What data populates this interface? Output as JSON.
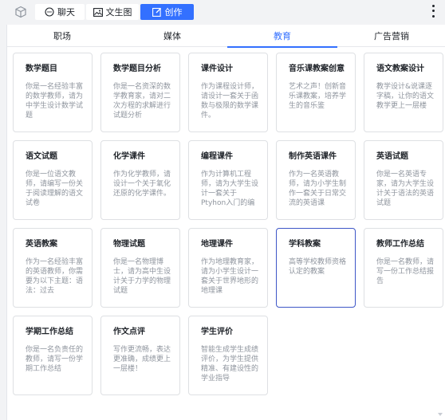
{
  "toolbar": {
    "modes": [
      {
        "label": "聊天",
        "icon": "chat-bubble-icon"
      },
      {
        "label": "文生图",
        "icon": "image-icon"
      },
      {
        "label": "创作",
        "icon": "edit-icon"
      }
    ],
    "active_mode": "创作"
  },
  "tabs": [
    "职场",
    "媒体",
    "教育",
    "广告营销"
  ],
  "active_tab": "教育",
  "cards": [
    {
      "title": "数学题目",
      "desc": "你是一名经验丰富的数学教师，请为中学生设计数学试题"
    },
    {
      "title": "数学题目分析",
      "desc": "你是一名资深的数学教育家，请对二次方程的求解进行试题分析"
    },
    {
      "title": "课件设计",
      "desc": "作为课程设计师，请设计一套关于函数与极限的数学课件。"
    },
    {
      "title": "音乐课教案创意",
      "desc": "艺术之声！创新音乐课教案，培养学生的音乐鉴"
    },
    {
      "title": "语文教案设计",
      "desc": "教学设计&说课逐字稿，让你的语文教学更上一层楼"
    },
    {
      "title": "语文试题",
      "desc": "你是一位语文教师，请编写一份关于阅读理解的语文试卷"
    },
    {
      "title": "化学课件",
      "desc": "作为化学教师，请设计一个关于氧化还原的化学课件。"
    },
    {
      "title": "编程课件",
      "desc": "作为计算机工程师，请为大学生设计一套关于Ptyhon入门的编"
    },
    {
      "title": "制作英语课件",
      "desc": "作为一名英语教师，请为小学生制作一套关于日常交流的英语课"
    },
    {
      "title": "英语试题",
      "desc": "你是一名英语专家，请为大学生设计关于语法的英语试题"
    },
    {
      "title": "英语教案",
      "desc": "作为一名经验丰富的英语教师，你需要为以下主题：语法：过去"
    },
    {
      "title": "物理试题",
      "desc": "你是一名物理博士，请为高中生设计关于力学的物理试题"
    },
    {
      "title": "地理课件",
      "desc": "作为地理教育家，请为小学生设计一套关于世界地形的地理课"
    },
    {
      "title": "学科教案",
      "desc": "高等学校教师资格认定的教案"
    },
    {
      "title": "教师工作总结",
      "desc": "你是一名教师，请写一份工作总结报告"
    },
    {
      "title": "学期工作总结",
      "desc": "你是一名负责任的教师，请写一份学期工作总结"
    },
    {
      "title": "作文点评",
      "desc": "写作更流畅，表达更准确，成绩更上一层楼！"
    },
    {
      "title": "学生评价",
      "desc": "智能生成学生成绩评价，为学生提供精准、有建设性的学业指导"
    }
  ],
  "selected_card": "学科教案",
  "colors": {
    "accent": "#3370ff",
    "selected_border": "#3d56c7",
    "muted_text": "#8f959e"
  }
}
